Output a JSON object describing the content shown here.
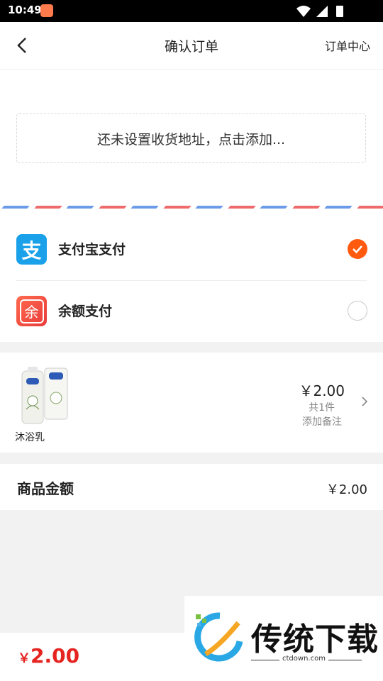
{
  "status_bar": {
    "time": "10:49"
  },
  "header": {
    "title": "确认订单",
    "right_link": "订单中心"
  },
  "address": {
    "placeholder_text": "还未设置收货地址，点击添加..."
  },
  "payment": {
    "options": [
      {
        "label": "支付宝支付",
        "icon_char": "支",
        "icon": "alipay-icon",
        "selected": true
      },
      {
        "label": "余额支付",
        "icon_char": "余",
        "icon": "balance-icon",
        "selected": false
      }
    ]
  },
  "product": {
    "name": "沐浴乳",
    "price": "￥2.00",
    "count": "共1件",
    "note_link": "添加备注"
  },
  "summary": {
    "label": "商品金额",
    "value": "￥2.00"
  },
  "bottom": {
    "currency": "￥",
    "total": "2.00"
  },
  "watermark": {
    "brand": "传统下载",
    "url": "ctdown.com"
  },
  "colors": {
    "accent": "#ff5a0e",
    "price_red": "#e5231f",
    "alipay_blue": "#1ba1ea"
  }
}
